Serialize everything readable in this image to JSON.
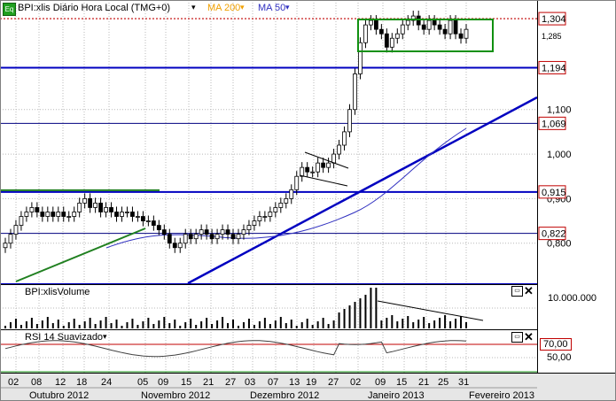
{
  "chart": {
    "instrument_badge": "Eq",
    "title": "BPI:xlis Diário Hora Local (TMG+0)",
    "ma200_label": "MA 200",
    "ma50_label": "MA 50",
    "colors": {
      "ma200": "#f0a000",
      "ma50": "#3030c0",
      "support_line": "#0000c0",
      "red_line": "#c00000",
      "green_line": "#208020",
      "badge": "#20a020"
    }
  },
  "price_axis": {
    "ticks": [
      "1,100",
      "1,000",
      "0,900",
      "0,800"
    ],
    "highlighted": [
      {
        "label": "1,304",
        "color": "#c00000"
      },
      {
        "label": "1,194",
        "color": "#c00000"
      },
      {
        "label": "1,069",
        "color": "#c00000"
      },
      {
        "label": "0,915",
        "color": "#c00000"
      },
      {
        "label": "0,822",
        "color": "#c00000"
      }
    ],
    "partial_label": "1,285"
  },
  "volume_panel": {
    "title": "BPI:xlisVolume",
    "tick": "10.000.000"
  },
  "rsi_panel": {
    "title": "RSI 14 Suavizado",
    "levels": [
      "70,00",
      "50,00"
    ]
  },
  "date_axis": {
    "days": [
      "02",
      "08",
      "12",
      "18",
      "24",
      "05",
      "09",
      "15",
      "21",
      "27",
      "03",
      "07",
      "13",
      "19",
      "27",
      "02",
      "09",
      "15",
      "21",
      "25",
      "31"
    ],
    "months": [
      "Outubro 2012",
      "Novembro 2012",
      "Dezembro 2012",
      "Janeiro 2013",
      "Fevereiro 2013"
    ]
  },
  "chart_data": {
    "type": "candlestick",
    "title": "BPI:xlis Diário Hora Local (TMG+0)",
    "series": [
      {
        "name": "MA 200"
      },
      {
        "name": "MA 50"
      }
    ],
    "ohlc_close": [
      0.8,
      0.82,
      0.84,
      0.86,
      0.87,
      0.88,
      0.87,
      0.86,
      0.87,
      0.86,
      0.87,
      0.86,
      0.86,
      0.87,
      0.89,
      0.9,
      0.88,
      0.89,
      0.87,
      0.88,
      0.87,
      0.86,
      0.87,
      0.87,
      0.86,
      0.86,
      0.85,
      0.85,
      0.84,
      0.83,
      0.82,
      0.8,
      0.79,
      0.8,
      0.82,
      0.81,
      0.82,
      0.83,
      0.82,
      0.81,
      0.82,
      0.83,
      0.82,
      0.81,
      0.82,
      0.83,
      0.84,
      0.85,
      0.86,
      0.86,
      0.87,
      0.88,
      0.89,
      0.9,
      0.92,
      0.95,
      0.97,
      0.96,
      0.96,
      0.98,
      0.97,
      0.98,
      1.0,
      1.02,
      1.05,
      1.1,
      1.18,
      1.25,
      1.29,
      1.3,
      1.28,
      1.27,
      1.24,
      1.26,
      1.27,
      1.29,
      1.3,
      1.31,
      1.29,
      1.28,
      1.3,
      1.29,
      1.28,
      1.27,
      1.3,
      1.27,
      1.26,
      1.28
    ],
    "horizontal_levels": [
      1.304,
      1.194,
      1.069,
      0.915,
      0.822
    ],
    "ylim": [
      0.71,
      1.33
    ],
    "volume_tick": 10000000,
    "rsi_levels": [
      70,
      50
    ],
    "x_tick_labels": [
      "02",
      "08",
      "12",
      "18",
      "24",
      "05",
      "09",
      "15",
      "21",
      "27",
      "03",
      "07",
      "13",
      "19",
      "27",
      "02",
      "09",
      "15",
      "21",
      "25",
      "31"
    ],
    "x_month_labels": [
      "Outubro 2012",
      "Novembro 2012",
      "Dezembro 2012",
      "Janeiro 2013",
      "Fevereiro 2013"
    ]
  }
}
